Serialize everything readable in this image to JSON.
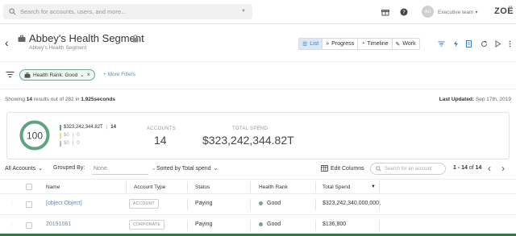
{
  "topbar": {
    "search_placeholder": "Search for accounts, users, and more...",
    "avatar_initials": "AH",
    "team_label": "Executive team ▾",
    "logo": "ZOË"
  },
  "header": {
    "title": "Abbey's Health Segment",
    "subtitle": "Abbey's Health Segment",
    "views": [
      {
        "label": "List",
        "glyph": "☰",
        "active": true
      },
      {
        "label": "Progress",
        "glyph": "»"
      },
      {
        "label": "Timeline",
        "glyph": "◔"
      },
      {
        "label": "Work",
        "glyph": "✎"
      }
    ]
  },
  "filters": {
    "chip_label": "Health Rank: Good",
    "more_label": "+ More Filters"
  },
  "summary": {
    "showing_prefix": "Showing",
    "showing_count": "14",
    "showing_mid": "results out of 282 in",
    "showing_time": "1.925seconds",
    "updated_label": "Last Updated:",
    "updated_value": "Sep 17th, 2019"
  },
  "stats": {
    "score": "100",
    "health": [
      {
        "amount": "$323,242,344.82T",
        "count": "14",
        "color": "#5fa37f"
      },
      {
        "amount": "$0",
        "count": "0",
        "color": "#f0d784"
      },
      {
        "amount": "$0",
        "count": "0",
        "color": "#b9b9b9"
      }
    ],
    "accounts_label": "ACCOUNTS",
    "accounts_value": "14",
    "spend_label": "TOTAL SPEND",
    "spend_value": "$323,242,344.82T",
    "score_fraction": 1.0
  },
  "toolbar": {
    "all_accounts": "All Accounts",
    "grouped_by_label": "Grouped By:",
    "grouped_by_value": "None",
    "sorted_by": "Sorted by Total spend",
    "edit_columns": "Edit Columns",
    "search_placeholder": "Search for an account",
    "pager_range": "1 - 14",
    "pager_of": "of",
    "pager_total": "14"
  },
  "table": {
    "headers": {
      "name": "Name",
      "account_type": "Account Type",
      "status": "Status",
      "health_rank": "Health Rank",
      "total_spend": "Total Spend"
    },
    "rows": [
      {
        "name": "[object Object]",
        "type": "ACCOUNT",
        "status": "Paying",
        "health": "Good",
        "spend": "$323,242,340,000,000,"
      },
      {
        "name": "20191081",
        "type": "CORPORATE",
        "status": "Paying",
        "health": "Good",
        "spend": "$136,800"
      }
    ]
  },
  "colors": {
    "good": "#5fa37f",
    "accent_blue": "#3f7cb8",
    "link": "#5b8fc4"
  }
}
